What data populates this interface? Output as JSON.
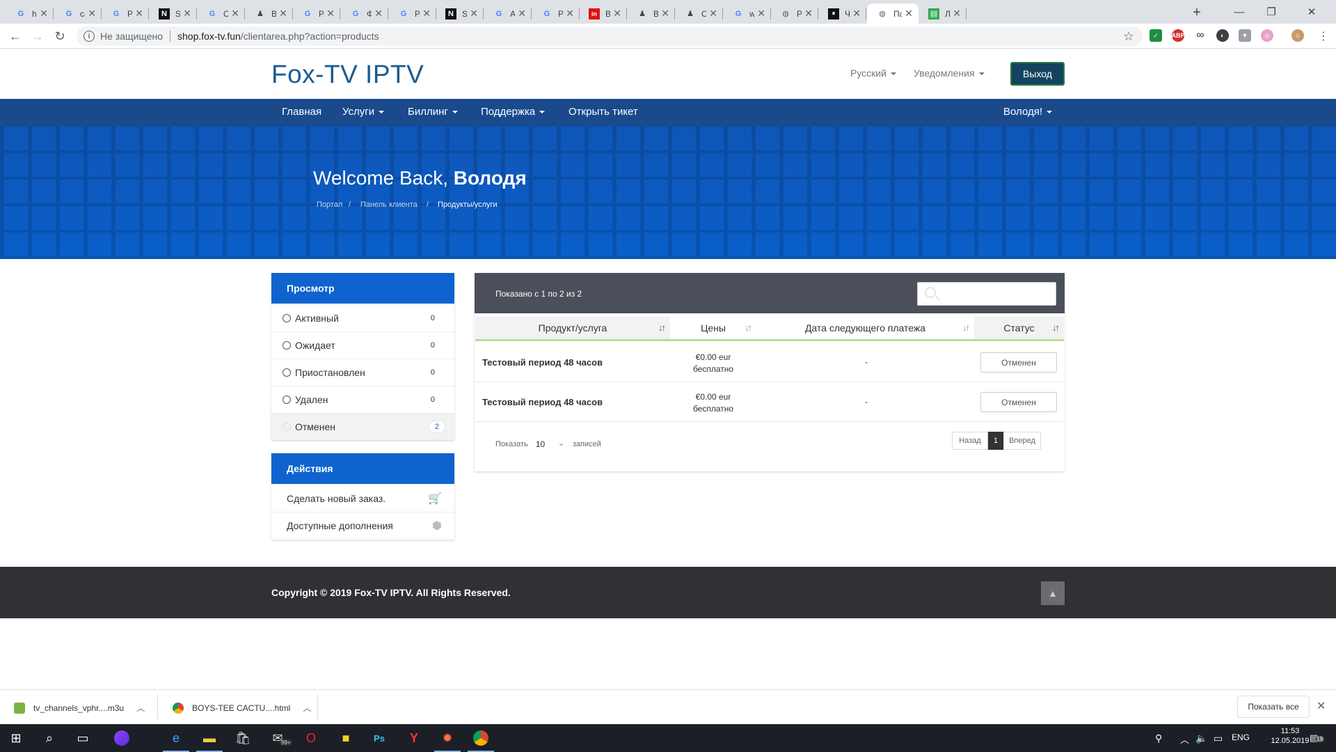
{
  "browser": {
    "tabs": [
      {
        "title": "hot",
        "icon": "google-icon"
      },
      {
        "title": "cact",
        "icon": "google-icon"
      },
      {
        "title": "Рез",
        "icon": "google-icon"
      },
      {
        "title": "Sho",
        "icon": "n-icon"
      },
      {
        "title": "ORI",
        "icon": "google-icon"
      },
      {
        "title": "BOY",
        "icon": "cactus-icon"
      },
      {
        "title": "PHF",
        "icon": "google-icon"
      },
      {
        "title": "Фил",
        "icon": "google-icon"
      },
      {
        "title": "Рез",
        "icon": "google-icon"
      },
      {
        "title": "Sho",
        "icon": "n-icon"
      },
      {
        "title": "AED",
        "icon": "google-icon"
      },
      {
        "title": "Рез",
        "icon": "google-icon"
      },
      {
        "title": "Buy",
        "icon": "linkedin-icon"
      },
      {
        "title": "BOY",
        "icon": "cactus-icon"
      },
      {
        "title": "Orig",
        "icon": "cactus-icon"
      },
      {
        "title": "wes",
        "icon": "google-icon"
      },
      {
        "title": "Pho",
        "icon": "globe-icon"
      },
      {
        "title": "Чар",
        "icon": "pause-icon"
      },
      {
        "title": "Пан",
        "icon": "globe-icon",
        "active": true
      },
      {
        "title": "Луч",
        "icon": "sheet-icon"
      }
    ],
    "new_tab": "+",
    "not_secure": "Не защищено",
    "url_host": "shop.fox-tv.fun",
    "url_path": "/clientarea.php?action=products"
  },
  "site": {
    "logo": "Fox-TV IPTV",
    "language": "Русский",
    "notifications": "Уведомления",
    "logout": "Выход",
    "nav": [
      "Главная",
      "Услуги",
      "Биллинг",
      "Поддержка",
      "Открыть тикет"
    ],
    "user_menu": "Володя!",
    "welcome_prefix": "Welcome Back,",
    "welcome_name": "Володя",
    "breadcrumb": [
      "Портал",
      "Панель клиента",
      "Продукты/услуги"
    ]
  },
  "sidebar": {
    "view_title": "Просмотр",
    "filters": [
      {
        "label": "Активный",
        "count": "0"
      },
      {
        "label": "Ожидает",
        "count": "0"
      },
      {
        "label": "Приостановлен",
        "count": "0"
      },
      {
        "label": "Удален",
        "count": "0"
      },
      {
        "label": "Отменен",
        "count": "2",
        "selected": true
      }
    ],
    "actions_title": "Действия",
    "actions": [
      {
        "label": "Сделать новый заказ.",
        "icon": "cart-icon"
      },
      {
        "label": "Доступные дополнения",
        "icon": "cubes-icon"
      }
    ]
  },
  "table": {
    "showing": "Показано с 1 по 2 из 2",
    "headers": [
      "Продукт/услуга",
      "Цены",
      "Дата следующего платежа",
      "Статус"
    ],
    "rows": [
      {
        "product": "Тестовый период 48 часов",
        "price": "€0.00 eur",
        "cycle": "бесплатно",
        "next_due": "-",
        "status": "Отменен"
      },
      {
        "product": "Тестовый период 48 часов",
        "price": "€0.00 eur",
        "cycle": "бесплатно",
        "next_due": "-",
        "status": "Отменен"
      }
    ],
    "show_label": "Показать",
    "per_page": "10",
    "records_label": "записей",
    "prev": "Назад",
    "page": "1",
    "next": "Вперед"
  },
  "footer": {
    "copyright": "Copyright © 2019 Fox-TV IPTV. All Rights Reserved."
  },
  "downloads": {
    "items": [
      "tv_channels_vphr....m3u",
      "BOYS-TEE CACTU....html"
    ],
    "show_all": "Показать все"
  },
  "taskbar": {
    "lang": "ENG",
    "time": "11:53",
    "date": "12.05.2019",
    "mail_badge": "99+",
    "notif_count": "19"
  },
  "colors": {
    "navbar": "#1a4a8c",
    "hero": "#0a5fc9",
    "panel_head": "#0e63cf",
    "table_top": "#4a4f5a",
    "header_underline": "#b9dc9c",
    "footer": "#2f3135",
    "logout": "#13435f"
  }
}
